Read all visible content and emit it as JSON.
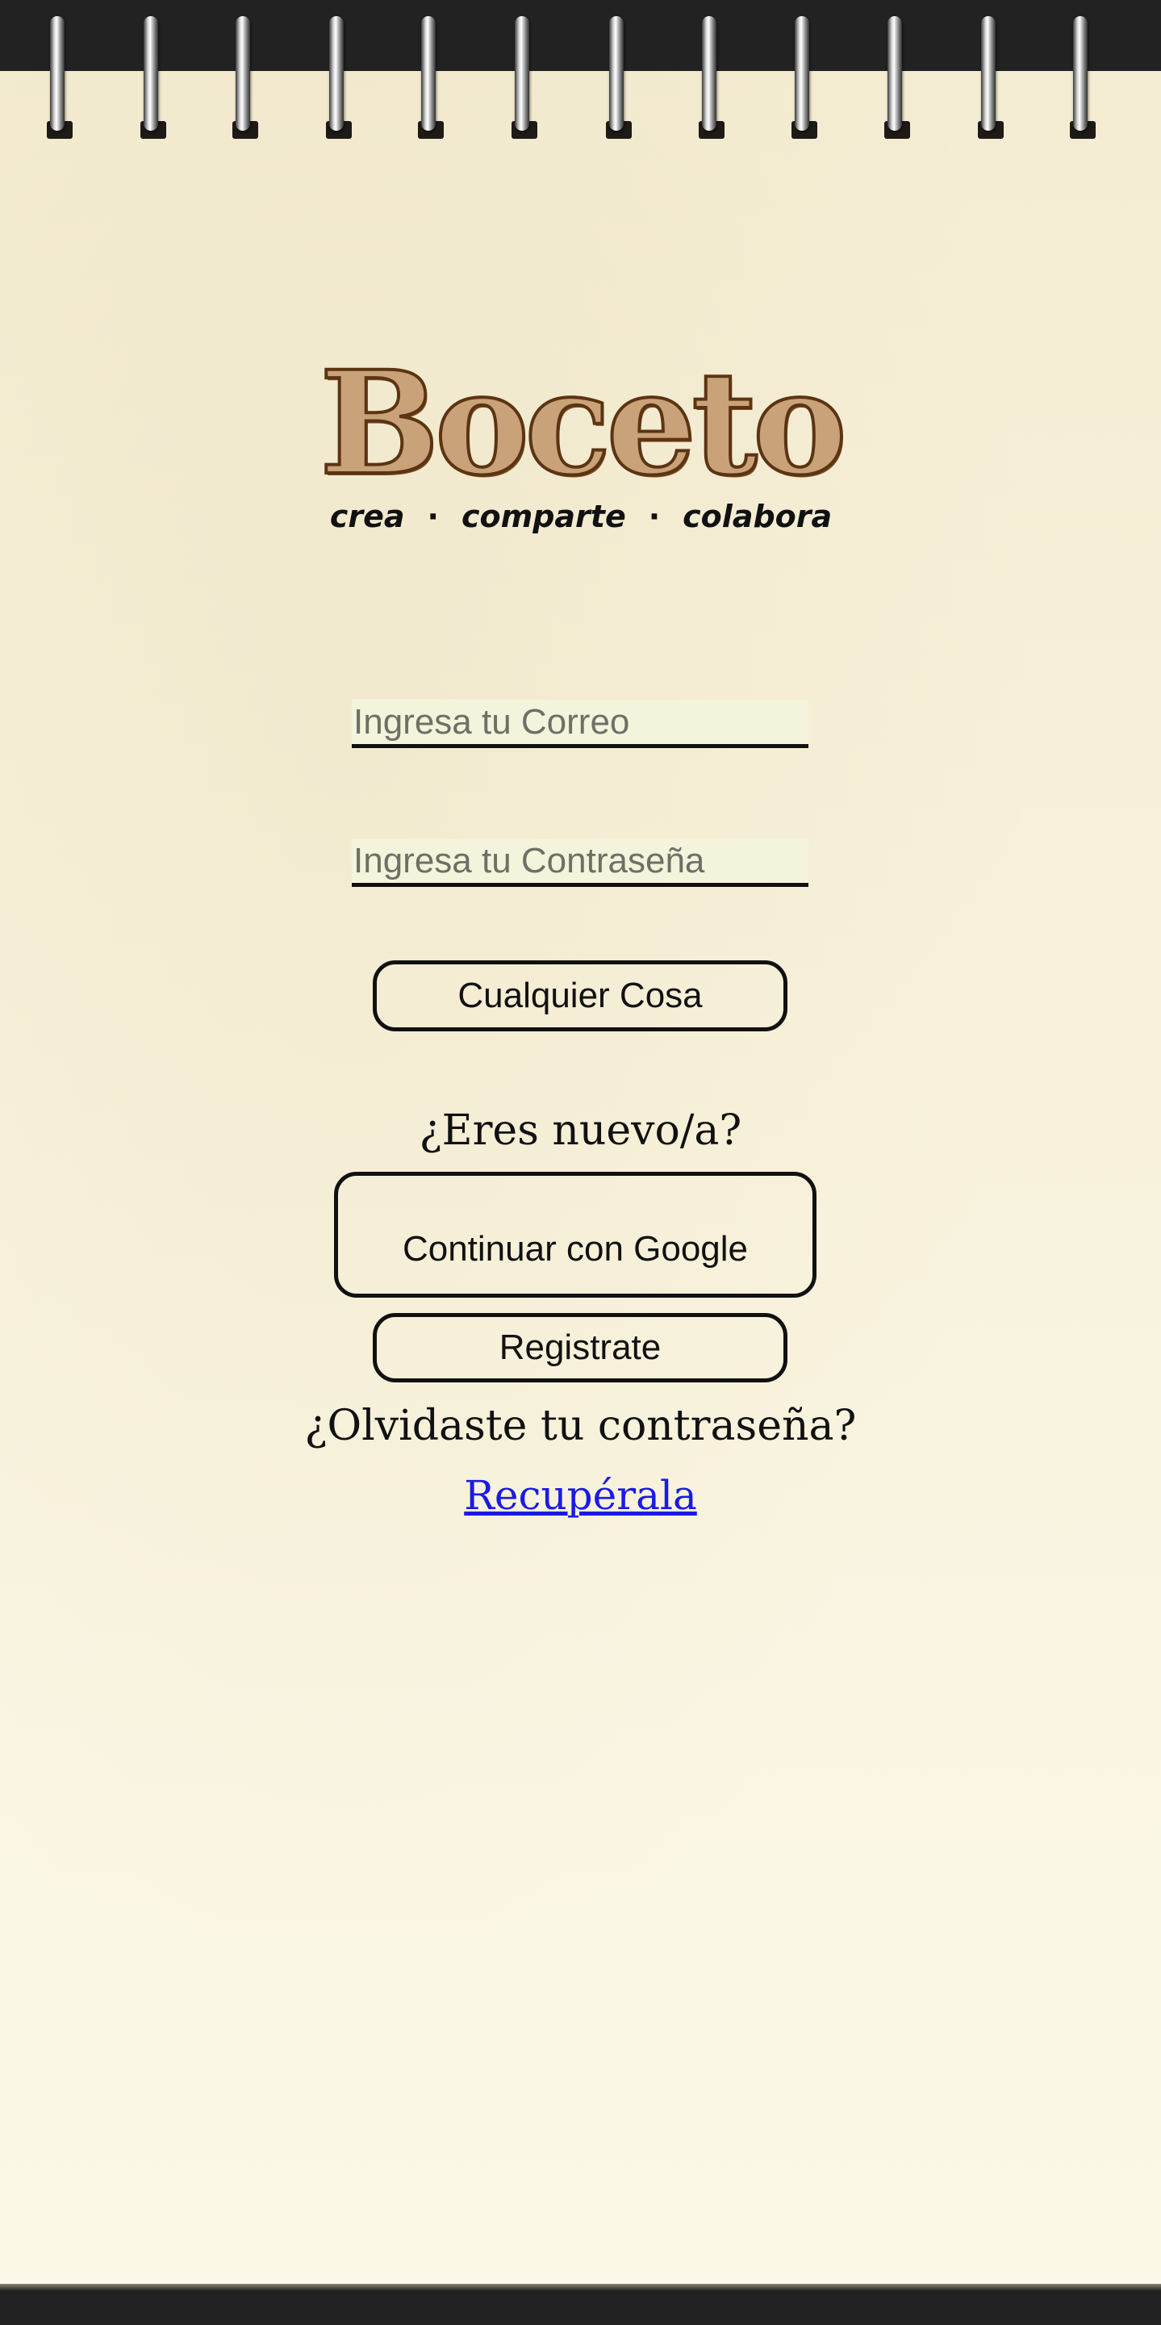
{
  "logo": {
    "title": "Boceto",
    "tagline": [
      "crea",
      "·",
      "comparte",
      "·",
      "colabora"
    ]
  },
  "login_form": {
    "email_placeholder": "Ingresa tu Correo",
    "password_placeholder": "Ingresa tu Contraseña",
    "submit_label": "Cualquier Cosa"
  },
  "signup": {
    "prompt": "¿Eres nuevo/a?",
    "google_label": "Continuar con Google",
    "register_label": "Registrate"
  },
  "recovery": {
    "prompt": "¿Olvidaste tu contraseña?",
    "link_label": "Recupérala"
  },
  "colors": {
    "background": "#222222",
    "paper": "#f8f2dc",
    "logo_fill": "#c9a27a",
    "logo_stroke": "#5b3412",
    "link": "#1a1ae6",
    "text": "#111111"
  },
  "icons": [
    "spiral-binding"
  ]
}
